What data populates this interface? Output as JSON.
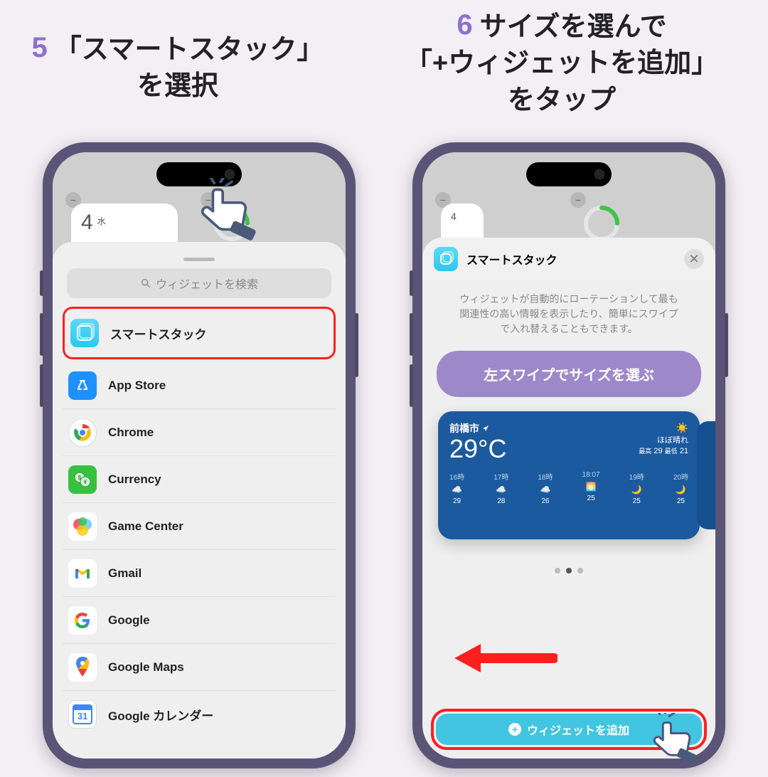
{
  "step5": {
    "number": "5",
    "line1": "「スマートスタック」",
    "line2": "を選択"
  },
  "step6": {
    "number": "6",
    "line1": "サイズを選んで",
    "line2": "「+ウィジェットを追加」",
    "line3": "をタップ"
  },
  "greyed": {
    "day_num": "4",
    "day_label": "水"
  },
  "search_placeholder": "ウィジェットを検索",
  "list": [
    "スマートスタック",
    "App Store",
    "Chrome",
    "Currency",
    "Game Center",
    "Gmail",
    "Google",
    "Google Maps",
    "Google カレンダー"
  ],
  "cal_num": "31",
  "right_sheet": {
    "title": "スマートスタック",
    "desc1": "ウィジェットが自動的にローテーションして最も",
    "desc2": "関連性の高い情報を表示したり、簡単にスワイプ",
    "desc3": "で入れ替えることもできます。",
    "tip": "左スワイプでサイズを選ぶ",
    "add_label": "ウィジェットを追加"
  },
  "weather": {
    "city": "前橋市",
    "temp": "29°C",
    "cond": "ほぼ晴れ",
    "hi_label": "最高",
    "hi": "29",
    "lo_label": "最低",
    "lo": "21",
    "hours": [
      {
        "t": "16時",
        "temp": "29"
      },
      {
        "t": "17時",
        "temp": "28"
      },
      {
        "t": "18時",
        "temp": "26"
      },
      {
        "t": "18:07",
        "temp": "25"
      },
      {
        "t": "19時",
        "temp": "25"
      },
      {
        "t": "20時",
        "temp": "25"
      }
    ]
  }
}
